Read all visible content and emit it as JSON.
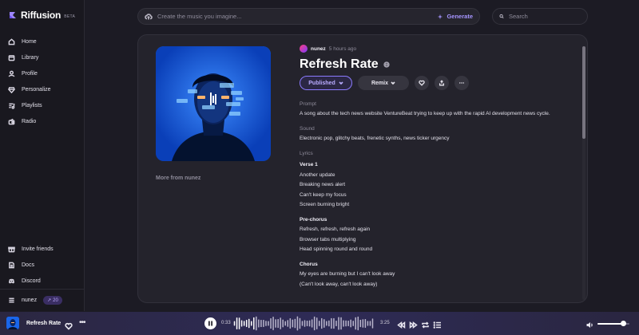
{
  "app": {
    "name": "Riffusion",
    "badge": "BETA"
  },
  "nav": [
    {
      "label": "Home",
      "icon": "home-icon"
    },
    {
      "label": "Library",
      "icon": "library-icon"
    },
    {
      "label": "Profile",
      "icon": "profile-icon"
    },
    {
      "label": "Personalize",
      "icon": "personalize-icon"
    },
    {
      "label": "Playlists",
      "icon": "playlists-icon"
    },
    {
      "label": "Radio",
      "icon": "radio-icon"
    }
  ],
  "nav_bottom": [
    {
      "label": "Invite friends",
      "icon": "invite-icon"
    },
    {
      "label": "Docs",
      "icon": "docs-icon"
    },
    {
      "label": "Discord",
      "icon": "discord-icon"
    }
  ],
  "user": {
    "name": "nunez",
    "credits": "20"
  },
  "create": {
    "placeholder": "Create the music you imagine...",
    "generate_label": "Generate"
  },
  "search": {
    "placeholder": "Search"
  },
  "song": {
    "author": "nunez",
    "time": "5 hours ago",
    "title": "Refresh Rate",
    "published_label": "Published",
    "remix_label": "Remix",
    "prompt_label": "Prompt",
    "prompt": "A song about the tech news website VentureBeat trying to keep up with the rapid AI development news cycle.",
    "sound_label": "Sound",
    "sound": "Electronic pop, glitchy beats, frenetic synths, news ticker urgency",
    "lyrics_label": "Lyrics",
    "more_from": "More from nunez",
    "lyrics": [
      {
        "head": "Verse 1",
        "lines": [
          "Another update",
          "Breaking news alert",
          "Can't keep my focus",
          "Screen burning bright"
        ]
      },
      {
        "head": "Pre-chorus",
        "lines": [
          "Refresh, refresh, refresh again",
          "Browser tabs multiplying",
          "Head spinning round and round"
        ]
      },
      {
        "head": "Chorus",
        "lines": [
          "My eyes are burning but I can't look away",
          "(Can't look away, can't look away)"
        ]
      }
    ]
  },
  "player": {
    "title": "Refresh Rate",
    "current_time": "0:33",
    "duration": "3:25",
    "progress": 0.16,
    "volume": 0.8
  },
  "colors": {
    "accent": "#a695ff",
    "background": "#1c1b24",
    "card": "#24232c",
    "player": "#2e2b56"
  }
}
